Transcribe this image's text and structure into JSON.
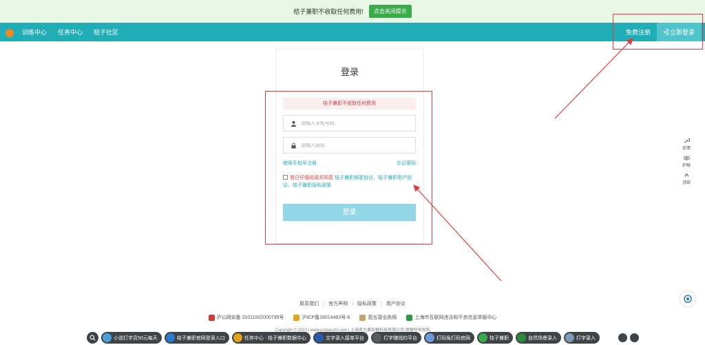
{
  "notice": {
    "text": "桔子兼职不收取任何费用!",
    "button": "点击关闭提示"
  },
  "nav": {
    "items": [
      "训练中心",
      "任务中心",
      "桔子社区"
    ],
    "register": "免费注册",
    "login": "立即登录"
  },
  "login": {
    "title": "登录",
    "alert": "桔子兼职不收取任何费用",
    "phone_placeholder": "请输入手机号码",
    "password_placeholder": "请输入密码",
    "register_link": "使用手机号注册",
    "forgot_link": "忘记密码",
    "agree_prefix": "我已仔细阅读并同意",
    "agree_terms": "桔子兼职保密协议、桔子兼职用户协议、桔子兼职隐私政策",
    "submit": "登录"
  },
  "tools": [
    "反馈",
    "护眼",
    "顶部"
  ],
  "footer": {
    "links": [
      "联系我们",
      "官方声明",
      "隐私政策",
      "用户协议"
    ],
    "beian": [
      {
        "text": "沪公网安备 31011002000735号",
        "color": "#d23b2b"
      },
      {
        "text": "沪ICP备18014493号-6",
        "color": "#e6a21a"
      },
      {
        "text": "盈五营业执照",
        "color": "#c8a46a"
      },
      {
        "text": "上海市互联网违法和不良信息举报中心",
        "color": "#2a9a3a"
      }
    ],
    "copyright": "Copyright © 2022  |  www.juzijianzhi.com  |  上海有九黄如据科技有限公司 保留所有权利"
  },
  "chips": [
    {
      "label": "小说打字员50元每天",
      "color": "#4aa0d8"
    },
    {
      "label": "桔子兼职官网登录入口",
      "color": "#2a7ad0"
    },
    {
      "label": "任务中心 · 桔子兼职数据中心",
      "color": "#e0a020"
    },
    {
      "label": "文字录入接单平台",
      "color": "#2a5ab0"
    },
    {
      "label": "打字赚钱的平台",
      "color": "#3a3a3a"
    },
    {
      "label": "打码兔打码官网",
      "color": "#6a9ad8"
    },
    {
      "label": "桔子兼职",
      "color": "#3aaa4a"
    },
    {
      "label": "自然场景录入",
      "color": "#2a8a3a"
    },
    {
      "label": "打字录入",
      "color": "#7a9ab8"
    }
  ],
  "colors": {
    "primary": "#21adb5",
    "annotation": "#e23b3b"
  }
}
